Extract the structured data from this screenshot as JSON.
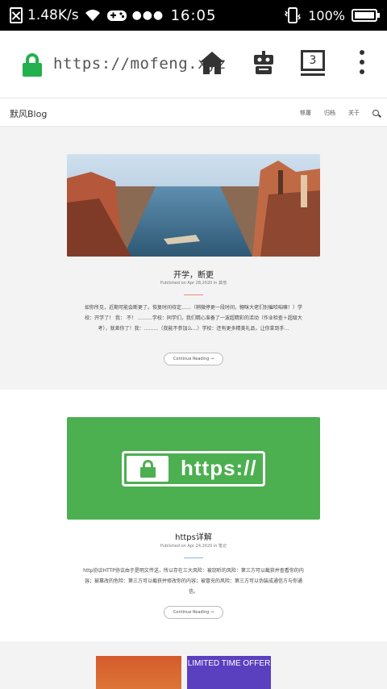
{
  "statusbar": {
    "network_speed": "1.48K/s",
    "time": "16:05",
    "battery_percent": "100%"
  },
  "browser": {
    "url": "https://mofeng.xyz",
    "tab_count": "3"
  },
  "site": {
    "brand": "默风Blog",
    "nav": [
      "够屠",
      "归档",
      "关于"
    ]
  },
  "posts": [
    {
      "title": "开学，断更",
      "meta": "Published on Apr 28,2020 in 其他",
      "excerpt": "如你所见，近期可能会断更了。恢复时间待定……（稍微停更一段时间，翱咪大佬们别催哈咱嘛！）学校：开学了！ 我： 不！ ………学校：同学们，我们精心准备了一波超精彩的活动（作业检查＋超级大考），就差你了！我：………（我能不参加么…）学校：还有更多精美礼品，让你拿到手…",
      "readmore": "Continue Reading →"
    },
    {
      "title": "https详解",
      "meta": "Published on Apr 24,2020 in 笔记",
      "excerpt": "http协议HTTP协议由于是明文传送，所以存在三大风险：被窃听的风险：第三方可以截获并查看你的内容；被篡改的危险：第三方可以截获并修改你的内容；被冒充的风险：第三方可以伪装成通信方与你通信。",
      "readmore": "Continue Reading →",
      "image_text": "https://"
    }
  ],
  "promo": {
    "text": "LIMITED TIME OFFER"
  },
  "colors": {
    "lock_green": "#22b14c",
    "https_green": "#4caf50",
    "rule_red": "#e58a7e",
    "rule_blue": "#8fb2d9",
    "promo_purple": "#5a3fbf"
  },
  "icons": [
    "sim-off-icon",
    "wifi-icon",
    "gamepad-icon",
    "more-dots-icon",
    "vibrate-icon",
    "battery-icon",
    "lock-icon",
    "home-icon",
    "robot-icon",
    "tabs-icon",
    "menu-icon",
    "search-icon"
  ]
}
